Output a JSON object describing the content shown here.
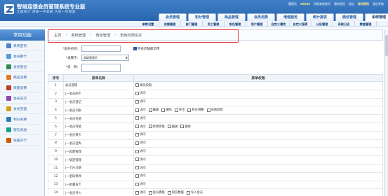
{
  "header": {
    "brand": "智络连锁会员管理系统专业版",
    "slogan": "全面统计 清晰一手掌握  乃智一体网集",
    "info": [
      "管理员",
      "admin",
      "切换其他身份",
      "我的首页",
      "退出",
      "修改密码",
      "退出系统"
    ],
    "accent": "#245fa8"
  },
  "main_tabs": [
    "会员管理",
    "积分管理",
    "商品管理",
    "会员消费",
    "增值服务",
    "统计报表",
    "微信管理",
    "系统管理"
  ],
  "sub_tabs": [
    "参数设置",
    "店铺管理",
    "部门管理",
    "员工管理",
    "角色管理",
    "用户管理",
    "自定义属性",
    "自定义报表",
    "公告管理",
    "系统日志",
    "数据管理"
  ],
  "sidebar": {
    "title": "常用功能",
    "items": [
      {
        "label": "系统首页",
        "color": "#4a84c9"
      },
      {
        "label": "会员刷卡",
        "color": "#5b9bd5"
      },
      {
        "label": "会员登记",
        "color": "#2e8b57"
      },
      {
        "label": "商品消费",
        "color": "#e07b2a"
      },
      {
        "label": "快速消费",
        "color": "#c0392b"
      },
      {
        "label": "会员充次",
        "color": "#8e44ad"
      },
      {
        "label": "会员充值",
        "color": "#d4a017"
      },
      {
        "label": "积分兑换",
        "color": "#2980b9"
      },
      {
        "label": "短信发送",
        "color": "#16a085"
      },
      {
        "label": "快速开卡",
        "color": "#d35400"
      }
    ]
  },
  "breadcrumb": [
    "主页",
    "系统管理",
    "角色管理",
    "角色权限设定"
  ],
  "form": {
    "name_label": "*角色名称：",
    "name_value": "",
    "copy_label": "所有店铺都可用",
    "parent_label": "*隶属于：",
    "parent_value": "超级管理员",
    "note_label": "*说　明：",
    "note_value": ""
  },
  "table": {
    "headers": [
      "序号",
      "菜单名称",
      "菜单权限"
    ],
    "rows": [
      {
        "no": "1",
        "name": "会员管理",
        "perms": [
          "模块权限"
        ]
      },
      {
        "no": "2",
        "name": "|—会员刷卡",
        "perms": [
          "访问"
        ]
      },
      {
        "no": "3",
        "name": "|—会员登记",
        "perms": [
          "访问"
        ]
      },
      {
        "no": "4",
        "name": "|—会员列表",
        "perms": [
          "访问",
          "编辑",
          "删除",
          "导出",
          "积分调整",
          "充值退款"
        ]
      },
      {
        "no": "5",
        "name": "|—会员充值",
        "perms": [
          "访问"
        ]
      },
      {
        "no": "6",
        "name": "|—会员等级",
        "perms": [
          "访问",
          "新增等级",
          "编辑",
          "删除"
        ]
      },
      {
        "no": "7",
        "name": "|—会员换卡",
        "perms": [
          "访问"
        ]
      },
      {
        "no": "8",
        "name": "|—会员挂失",
        "perms": [
          "访问"
        ]
      },
      {
        "no": "9",
        "name": "|—延期管理",
        "perms": [
          "访问"
        ]
      },
      {
        "no": "10",
        "name": "|—锁定管理",
        "perms": [
          "访问"
        ]
      },
      {
        "no": "11",
        "name": "|—卡片过期",
        "perms": [
          "访问"
        ]
      },
      {
        "no": "12",
        "name": "|—密码修改",
        "perms": [
          "访问"
        ]
      },
      {
        "no": "13",
        "name": "|—批量发卡",
        "perms": [
          "访问"
        ]
      },
      {
        "no": "14",
        "name": "|—会员导入",
        "perms": [
          "访问",
          "会员模板",
          "短信数据",
          "导入会员"
        ]
      }
    ]
  }
}
